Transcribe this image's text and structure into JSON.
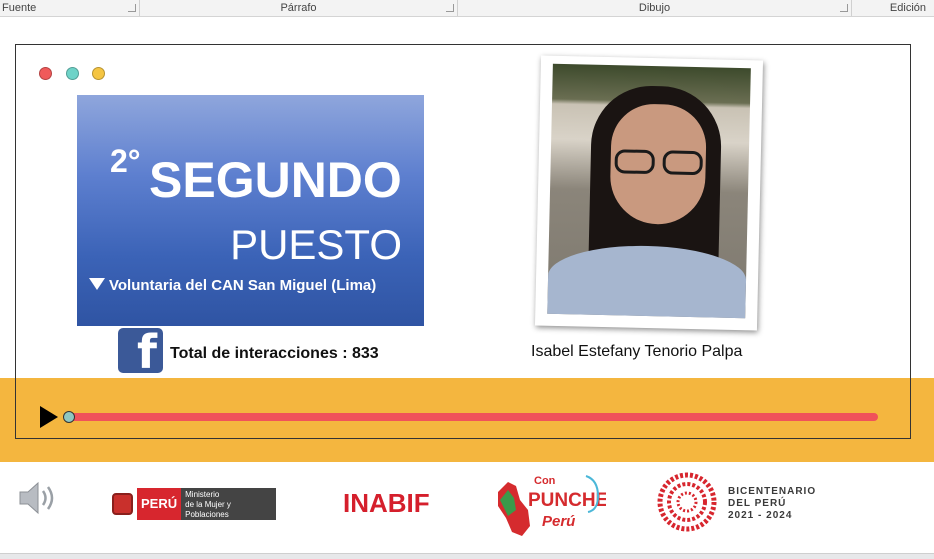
{
  "ribbon": {
    "groups": [
      {
        "label": "Fuente"
      },
      {
        "label": "Párrafo"
      },
      {
        "label": "Dibujo"
      },
      {
        "label": "Edición"
      }
    ]
  },
  "slide": {
    "window_dots": {
      "colors": [
        "#f05a5a",
        "#6ed3c8",
        "#f5c542"
      ]
    },
    "title": {
      "place_number": "2°",
      "place_title": "SEGUNDO",
      "place_subtitle": "PUESTO",
      "description": "Voluntaria del CAN San Miguel (Lima)",
      "gradient_top": "#8fa6dc",
      "gradient_bottom": "#2f54a3"
    },
    "facebook": {
      "icon": "facebook-icon",
      "interactions_text": "Total de interacciones : 833"
    },
    "person": {
      "name": "Isabel Estefany Tenorio Palpa"
    },
    "player": {
      "band_color": "#f4b63f",
      "track_color": "#f0525a",
      "progress": 0.0,
      "play_icon": "play-icon"
    },
    "logos": {
      "speaker_icon": "speaker-icon",
      "mimp": {
        "peru": "PERÚ",
        "name_lines": [
          "Ministerio",
          "de la Mujer y",
          "Poblaciones Vulnerables"
        ]
      },
      "inabif": "INABIF",
      "punche": {
        "line1": "Con",
        "line2": "PUNCHE",
        "line3": "Perú"
      },
      "bicentenario": {
        "line1": "BICENTENARIO",
        "line2": "DEL PERÚ",
        "line3": "2021 - 2024"
      }
    }
  }
}
